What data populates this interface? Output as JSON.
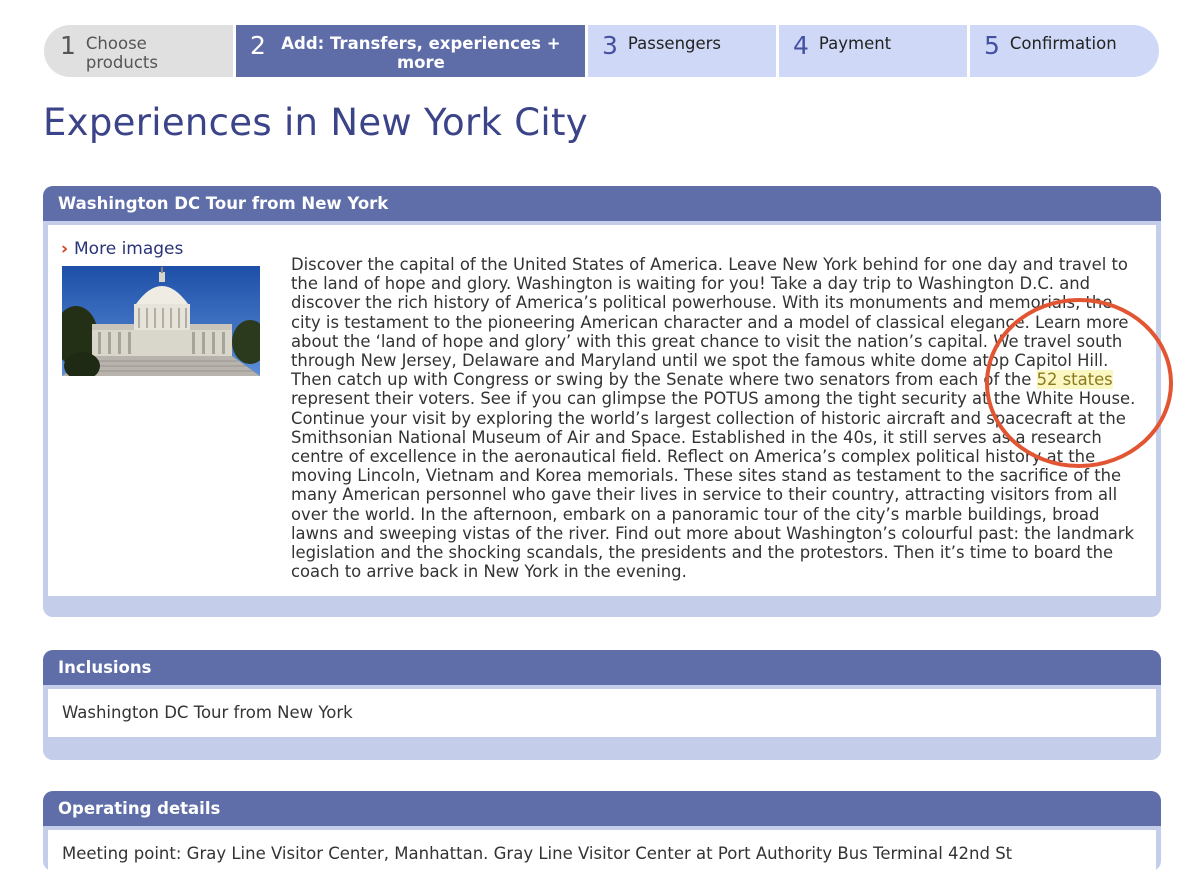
{
  "steps": [
    {
      "num": "1",
      "label": "Choose products"
    },
    {
      "num": "2",
      "label": "Add: Transfers, experiences + more"
    },
    {
      "num": "3",
      "label": "Passengers"
    },
    {
      "num": "4",
      "label": "Payment"
    },
    {
      "num": "5",
      "label": "Confirmation"
    }
  ],
  "page": {
    "title": "Experiences in New York City"
  },
  "tour": {
    "title": "Washington DC Tour from New York",
    "more_images": "More images",
    "description_before": "Discover the capital of the United States of America. Leave New York behind for one day and travel to the land of hope and glory. Washington is waiting for you! Take a day trip to Washington D.C. and discover the rich history of America’s political powerhouse. With its monuments and memorials, the city is testament to the pioneering American character and a model of classical elegance. Learn more about the ‘land of hope and glory’ with this great chance to visit the nation’s capital. We travel south through New Jersey, Delaware and Maryland until we spot the famous white dome atop Capitol Hill. Then catch up with Congress or swing by the Senate where two senators from each of the ",
    "highlight": "52 states",
    "description_after": " represent their voters. See if you can glimpse the POTUS among the tight security at the White House. Continue your visit by exploring the world’s largest collection of historic aircraft and spacecraft at the Smithsonian National Museum of Air and Space. Established in the 40s, it still serves as a research centre of excellence in the aeronautical field. Reflect on America’s complex political history at the moving Lincoln, Vietnam and Korea memorials. These sites stand as testament to the sacrifice of the many American personnel who gave their lives in service to their country, attracting visitors from all over the world. In the afternoon, embark on a panoramic tour of the city’s marble buildings, broad lawns and sweeping vistas of the river. Find out more about Washington’s colourful past: the landmark legislation and the shocking scandals, the presidents and the protestors. Then it’s time to board the coach to arrive back in New York in the evening."
  },
  "inclusions": {
    "title": "Inclusions",
    "item": "Washington DC Tour from New York"
  },
  "operating": {
    "title": "Operating details",
    "text": "Meeting point: Gray Line Visitor Center, Manhattan. Gray Line Visitor Center at Port Authority Bus Terminal 42nd St"
  },
  "colors": {
    "accent": "#5f6ea9",
    "step_todo": "#cfd9f7",
    "annotation": "#e25533",
    "highlight": "#fbf7c2"
  }
}
